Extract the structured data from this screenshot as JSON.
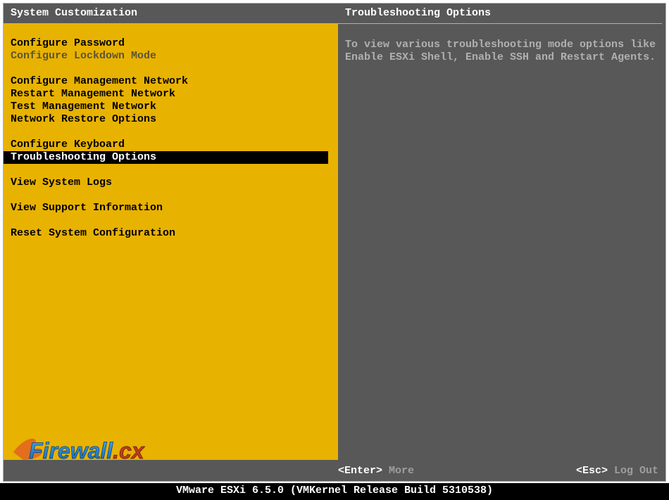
{
  "left": {
    "title": "System Customization",
    "items": [
      {
        "label": "Configure Password",
        "disabled": false
      },
      {
        "label": "Configure Lockdown Mode",
        "disabled": true
      },
      {
        "gap": true
      },
      {
        "label": "Configure Management Network",
        "disabled": false
      },
      {
        "label": "Restart Management Network",
        "disabled": false
      },
      {
        "label": "Test Management Network",
        "disabled": false
      },
      {
        "label": "Network Restore Options",
        "disabled": false
      },
      {
        "gap": true
      },
      {
        "label": "Configure Keyboard",
        "disabled": false
      },
      {
        "label": "Troubleshooting Options",
        "disabled": false,
        "selected": true
      },
      {
        "gap": true
      },
      {
        "label": "View System Logs",
        "disabled": false
      },
      {
        "gap": true
      },
      {
        "label": "View Support Information",
        "disabled": false
      },
      {
        "gap": true
      },
      {
        "label": "Reset System Configuration",
        "disabled": false
      }
    ]
  },
  "right": {
    "title": "Troubleshooting Options",
    "description": "To view various troubleshooting mode options like Enable ESXi Shell, Enable SSH and Restart Agents."
  },
  "footer": {
    "enter_key": "<Enter>",
    "enter_label": "More",
    "esc_key": "<Esc>",
    "esc_label": "Log Out"
  },
  "bottom": {
    "product": "VMware ESXi 6.5.0 (VMKernel Release Build 5310538)"
  },
  "watermark": {
    "text_primary": "Firewall",
    "text_suffix": ".cx"
  }
}
